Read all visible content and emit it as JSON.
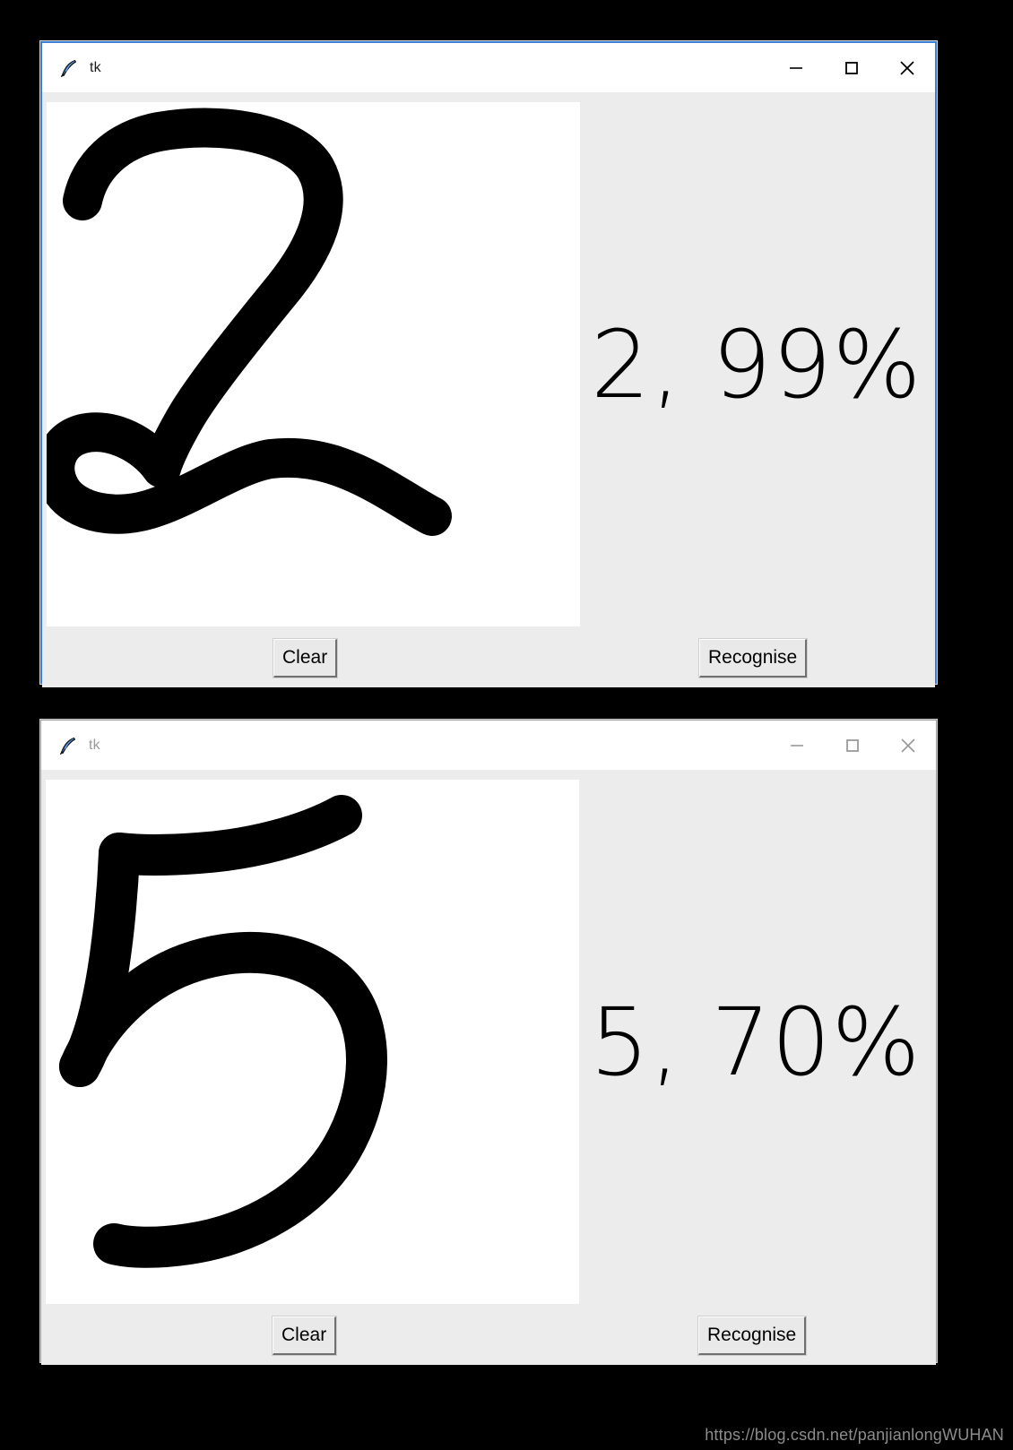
{
  "windows": [
    {
      "title": "tk",
      "icon": "feather-icon",
      "state": "active",
      "controls": {
        "minimize": "minimize-icon",
        "maximize": "maximize-icon",
        "close": "close-icon"
      },
      "canvas": {
        "drawn_digit": "2",
        "stroke_color": "#000000",
        "background": "#ffffff"
      },
      "result": "2, 99%",
      "buttons": {
        "clear": "Clear",
        "recognise": "Recognise"
      }
    },
    {
      "title": "tk",
      "icon": "feather-icon",
      "state": "inactive",
      "controls": {
        "minimize": "minimize-icon",
        "maximize": "maximize-icon",
        "close": "close-icon"
      },
      "canvas": {
        "drawn_digit": "5",
        "stroke_color": "#000000",
        "background": "#ffffff"
      },
      "result": "5, 70%",
      "buttons": {
        "clear": "Clear",
        "recognise": "Recognise"
      }
    }
  ],
  "watermark": "https://blog.csdn.net/panjianlongWUHAN",
  "colors": {
    "active_border": "#3a7fd5",
    "inactive_border": "#9b9b9b",
    "window_bg": "#ececec",
    "titlebar_bg": "#ffffff",
    "page_bg": "#000000"
  }
}
